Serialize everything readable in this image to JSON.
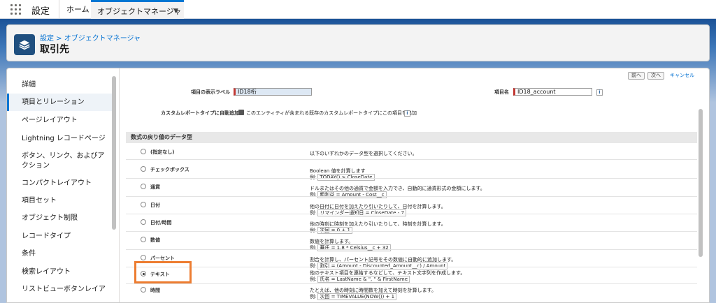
{
  "topbar": {
    "app_name": "設定",
    "tabs": [
      {
        "label": "ホーム"
      },
      {
        "label": "オブジェクトマネージャ"
      }
    ]
  },
  "header": {
    "breadcrumb": "設定 > オブジェクトマネージャ",
    "title": "取引先"
  },
  "sidebar": {
    "items": [
      {
        "label": "詳細"
      },
      {
        "label": "項目とリレーション"
      },
      {
        "label": "ページレイアウト"
      },
      {
        "label": "Lightning レコードページ"
      },
      {
        "label": "ボタン、リンク、およびア"
      },
      {
        "label": "クション"
      },
      {
        "label": "コンパクトレイアウト"
      },
      {
        "label": "項目セット"
      },
      {
        "label": "オブジェクト制限"
      },
      {
        "label": "レコードタイプ"
      },
      {
        "label": "条件"
      },
      {
        "label": "検索レイアウト"
      },
      {
        "label": "リストビューボタンレイア"
      }
    ]
  },
  "buttons": {
    "prev": "前へ",
    "next": "次へ",
    "cancel": "キャンセル"
  },
  "form": {
    "field_label_caption": "項目の表示ラベル",
    "field_label_value": "ID18桁",
    "field_name_caption": "項目名",
    "field_name_value": "ID18_account",
    "report_caption": "カスタムレポートタイプに自動追加",
    "report_text": "このエンティティが含まれる既存のカスタムレポートタイプにこの項目を追加",
    "info": "i"
  },
  "section": {
    "title": "数式の戻り値のデータ型"
  },
  "options": [
    {
      "label": "(指定なし)",
      "desc": "以下のいずれかのデータ型を選択してください。",
      "ex_prefix": "",
      "ex": ""
    },
    {
      "label": "チェックボックス",
      "desc": "Boolean 値を計算します",
      "ex_prefix": "例:",
      "ex": "TODAY() > CloseDate"
    },
    {
      "label": "通貨",
      "desc": "ドルまたはその他の通貨で金額を入力でき、自動的に通貨形式の金額にします。",
      "ex_prefix": "例:",
      "ex": "粗利益 = Amount - Cost__c"
    },
    {
      "label": "日付",
      "desc": "他の日付に日付を加えたり引いたりして、日付を計算します。",
      "ex_prefix": "例:",
      "ex": "リマインダー通知日 = CloseDate - 7"
    },
    {
      "label": "日付/時間",
      "desc": "他の時刻に時刻を加えたり引いたりして、時刻を計算します。",
      "ex_prefix": "例:",
      "ex": "次回 = 0 + 1"
    },
    {
      "label": "数値",
      "desc": "数値を計算します。",
      "ex_prefix": "例:",
      "ex": "華氏 = 1.8 * Celsius__c + 32"
    },
    {
      "label": "パーセント",
      "desc": "割合を計算し、パーセント記号をその数値に自動的に追加します。",
      "ex_prefix": "例:",
      "ex": "割引 = (Amount - Discounted_Amount__c) / Amount"
    },
    {
      "label": "テキスト",
      "desc": "他のテキスト項目を連結するなどして、テキスト文字列を作成します。",
      "ex_prefix": "例:",
      "ex": "氏名 = LastName & \", \" & FirstName"
    },
    {
      "label": "時間",
      "desc": "たとえば、他の時刻に時間数を加えて時刻を計算します。",
      "ex_prefix": "例:",
      "ex": "次回 = TIMEVALUE(NOW()) + 1"
    }
  ],
  "selected_option": "テキスト",
  "colors": {
    "accent": "#0176d3",
    "header_icon": "#1f4f7f",
    "required_bar": "#c23934",
    "highlight": "#ed7d31"
  }
}
